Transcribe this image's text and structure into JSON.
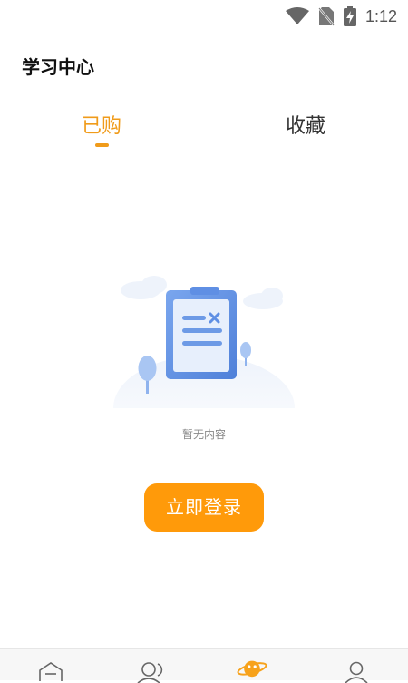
{
  "status_bar": {
    "time": "1:12",
    "icons": [
      "wifi-icon",
      "no-sim-icon",
      "battery-charging-icon"
    ]
  },
  "header": {
    "title": "学习中心"
  },
  "tabs": [
    {
      "label": "已购",
      "active": true
    },
    {
      "label": "收藏",
      "active": false
    }
  ],
  "empty_state": {
    "illustration": "empty-clipboard-illustration",
    "message": "暂无内容"
  },
  "login_button": {
    "label": "立即登录"
  },
  "bottom_nav": {
    "items": [
      {
        "icon": "home-icon"
      },
      {
        "icon": "community-icon"
      },
      {
        "icon": "explore-planet-icon",
        "active": true
      },
      {
        "icon": "profile-icon"
      }
    ]
  },
  "colors": {
    "accent": "#f09b1a",
    "button": "#ff9a0a",
    "illustration_blue": "#5f8fe4"
  }
}
